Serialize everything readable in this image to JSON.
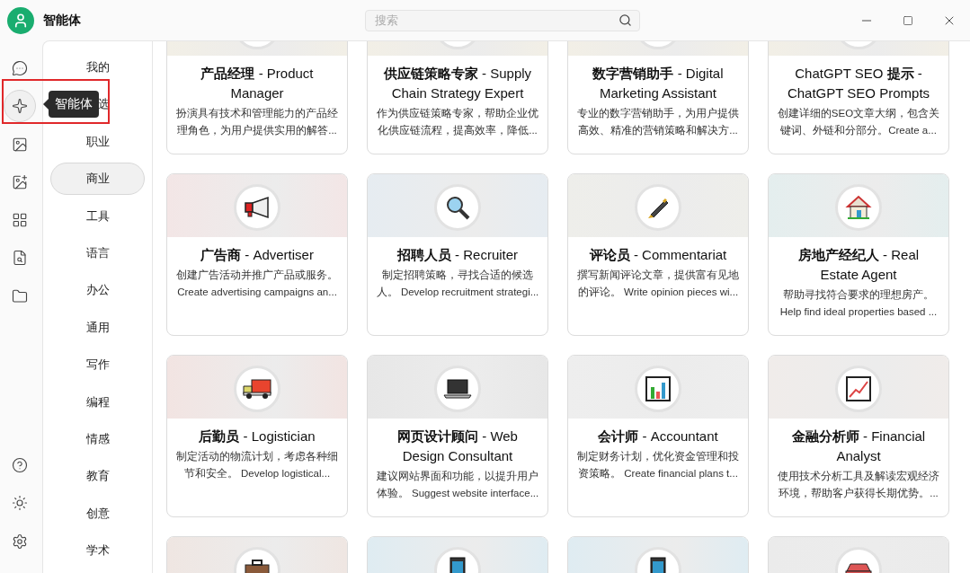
{
  "window": {
    "title": "智能体"
  },
  "search": {
    "placeholder": "搜索"
  },
  "rail": {
    "items": [
      {
        "kind": "chat",
        "selected": false
      },
      {
        "kind": "agent",
        "selected": true,
        "tooltip": "智能体"
      },
      {
        "kind": "image",
        "selected": false
      },
      {
        "kind": "image-text",
        "selected": false
      },
      {
        "kind": "apps",
        "selected": false
      },
      {
        "kind": "doc-search",
        "selected": false
      },
      {
        "kind": "folder",
        "selected": false
      }
    ],
    "bottom_items": [
      {
        "kind": "help"
      },
      {
        "kind": "theme"
      },
      {
        "kind": "settings"
      }
    ]
  },
  "highlight_frame": true,
  "categories": [
    {
      "label": "我的",
      "selected": false,
      "partial": false
    },
    {
      "label": "选",
      "selected": false,
      "partial": true
    },
    {
      "label": "职业",
      "selected": false,
      "partial": false
    },
    {
      "label": "商业",
      "selected": true,
      "partial": false
    },
    {
      "label": "工具",
      "selected": false,
      "partial": false
    },
    {
      "label": "语言",
      "selected": false,
      "partial": false
    },
    {
      "label": "办公",
      "selected": false,
      "partial": false
    },
    {
      "label": "通用",
      "selected": false,
      "partial": false
    },
    {
      "label": "写作",
      "selected": false,
      "partial": false
    },
    {
      "label": "编程",
      "selected": false,
      "partial": false
    },
    {
      "label": "情感",
      "selected": false,
      "partial": false
    },
    {
      "label": "教育",
      "selected": false,
      "partial": false
    },
    {
      "label": "创意",
      "selected": false,
      "partial": false
    },
    {
      "label": "学术",
      "selected": false,
      "partial": false
    }
  ],
  "cards": [
    {
      "kind": "hidden",
      "title": "**产品经理** - Product Manager",
      "description": "扮演具有技术和管理能力的产品经理角色，为用户提供实用的解答..."
    },
    {
      "kind": "hidden",
      "title": "**供应链策略专家** - Supply Chain Strategy Expert",
      "description": "作为供应链策略专家，帮助企业优化供应链流程，提高效率，降低..."
    },
    {
      "kind": "hidden",
      "title": "**数字营销助手** - Digital Marketing Assistant",
      "description": "专业的数字营销助手，为用户提供高效、精准的营销策略和解决方..."
    },
    {
      "kind": "hidden",
      "title": "ChatGPT SEO **提示** - ChatGPT SEO Prompts",
      "description": "创建详细的SEO文章大纲，包含关键词、外链和分部分。Create a..."
    },
    {
      "kind": "megaphone",
      "title": "**广告商** - Advertiser",
      "description": "创建广告活动并推广产品或服务。 Create advertising campaigns an..."
    },
    {
      "kind": "magnifier",
      "title": "**招聘人员** - Recruiter",
      "description": "制定招聘策略，寻找合适的候选人。 Develop recruitment strategi..."
    },
    {
      "kind": "pen",
      "title": "**评论员** - Commentariat",
      "description": "撰写新闻评论文章，提供富有见地的评论。 Write opinion pieces wi..."
    },
    {
      "kind": "house",
      "title": "**房地产经纪人** - Real Estate Agent",
      "description": "帮助寻找符合要求的理想房产。 Help find ideal properties based ..."
    },
    {
      "kind": "truck",
      "title": "**后勤员** - Logistician",
      "description": "制定活动的物流计划，考虑各种细节和安全。 Develop logistical..."
    },
    {
      "kind": "laptop",
      "title": "**网页设计顾问** - Web Design Consultant",
      "description": "建议网站界面和功能，以提升用户体验。 Suggest website interface..."
    },
    {
      "kind": "bar-chart",
      "title": "**会计师** - Accountant",
      "description": "制定财务计划，优化资金管理和投资策略。 Create financial plans t..."
    },
    {
      "kind": "line-chart",
      "title": "**金融分析师** - Financial Analyst",
      "description": "使用技术分析工具及解读宏观经济环境，帮助客户获得长期优势。..."
    },
    {
      "kind": "briefcase"
    },
    {
      "kind": "phone"
    },
    {
      "kind": "phone"
    },
    {
      "kind": "car"
    }
  ]
}
